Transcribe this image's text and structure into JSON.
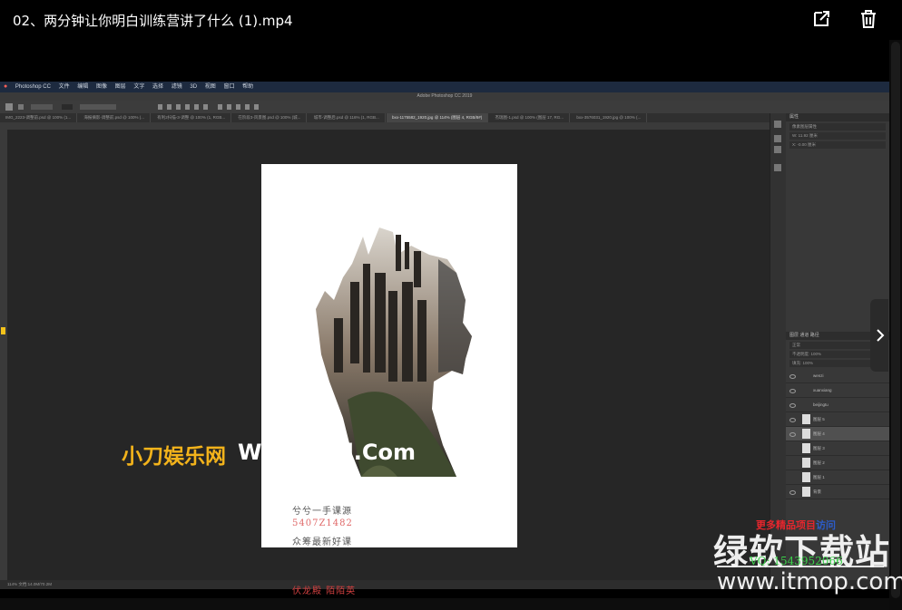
{
  "header": {
    "title": "02、两分钟让你明白训练营讲了什么 (1).mp4",
    "open_external_icon": "open-external-icon",
    "delete_icon": "trash-icon"
  },
  "photoshop": {
    "menu": [
      "Photoshop CC",
      "文件",
      "编辑",
      "图像",
      "图层",
      "文字",
      "选择",
      "滤镜",
      "3D",
      "视图",
      "窗口",
      "帮助"
    ],
    "window_title": "Adobe Photoshop CC 2019",
    "tabs": [
      "IMG_2223-调整前.psd @ 100% (1...",
      "海报摘影-调整前.psd @ 100% (...",
      "有利2扫描-3-调整 @ 100% (1, RGB...",
      "在阶段3-风景图.psd @ 100% (城...",
      "城市-调整后.psd @ 116% (1, RGB...",
      "bxx-1175582_1920.jpg @ 114% (图层 4, RGB/8#)",
      "杰瑞图-1.psd @ 100% (图层 17, RG...",
      "bxx-3576031_1920.jpg @ 100% (..."
    ],
    "active_tab_index": 5,
    "poster_lines": [
      "兮兮一手课源",
      "5407Z1482",
      "众筹最新好课",
      "伏龙殿 陌陌英"
    ],
    "poster_colors": [
      "#555555",
      "#e06a6a",
      "#555555",
      "#d04040"
    ],
    "panels": {
      "properties_tab": "属性",
      "properties_title": "像素图层属性",
      "w_label": "W: 11.92 厘米",
      "h_label": "H: 16.94 厘米",
      "x_label": "X: -0.00 厘米",
      "y_label": "Y: 0.00 厘米",
      "layer_tabs": "图层  通道  路径",
      "blend_mode": "正常",
      "opacity": "不透明度: 100%",
      "fill": "填充: 100%",
      "layers": [
        "wenzi",
        "xuanxiang",
        "beijingtu",
        "图层 5",
        "图层 4",
        "图层 3",
        "图层 2",
        "图层 1",
        "背景"
      ],
      "selected_layer_index": 4
    },
    "status": "114%     文档:14.0M/70.2M"
  },
  "watermarks": {
    "site_name_cn": "小刀娱乐网",
    "site_url_partial": "Www.x6d.Com",
    "tag_red": "更多精品项目",
    "tag_blue": "访问",
    "qq": "VQ: 1543952066",
    "brand": "绿软下载站",
    "brand_url": "www.itmop.com"
  },
  "colors": {
    "accent_gold": "#f3b31b",
    "ps_menubar": "#1d2a3f",
    "ps_bg": "#262626"
  },
  "nav": {
    "next_icon": "chevron-right-icon"
  }
}
